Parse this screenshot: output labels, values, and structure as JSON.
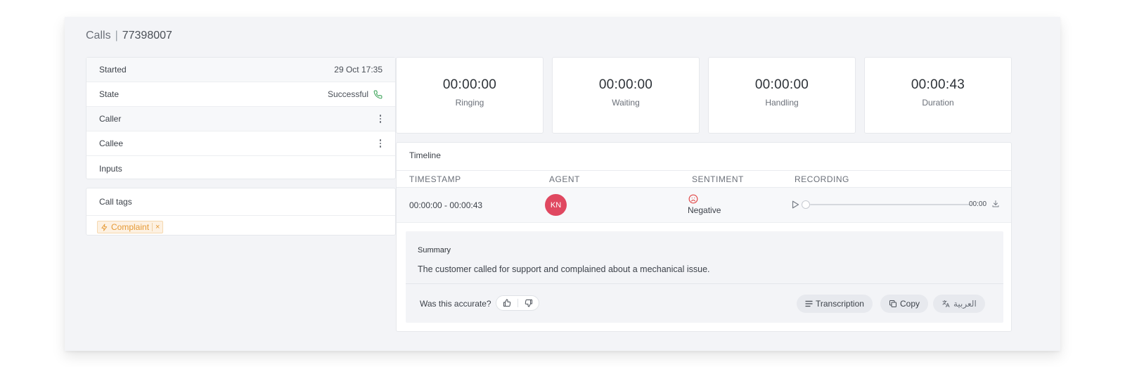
{
  "breadcrumb": {
    "section": "Calls",
    "separator": "|",
    "id": "77398007"
  },
  "info": {
    "rows": [
      {
        "label": "Started",
        "value": "29 Oct 17:35"
      },
      {
        "label": "State",
        "value": "Successful"
      },
      {
        "label": "Caller"
      },
      {
        "label": "Callee"
      },
      {
        "label": "Inputs"
      }
    ]
  },
  "tags": {
    "title": "Call tags",
    "items": [
      {
        "label": "Complaint",
        "remove": "×"
      }
    ]
  },
  "stats": [
    {
      "value": "00:00:00",
      "label": "Ringing"
    },
    {
      "value": "00:00:00",
      "label": "Waiting"
    },
    {
      "value": "00:00:00",
      "label": "Handling"
    },
    {
      "value": "00:00:43",
      "label": "Duration"
    }
  ],
  "timeline": {
    "title": "Timeline",
    "columns": [
      "TIMESTAMP",
      "AGENT",
      "SENTIMENT",
      "RECORDING"
    ],
    "row": {
      "timestamp": "00:00:00 - 00:00:43",
      "agent_initials": "KN",
      "sentiment": "Negative",
      "recording_time": "00:00",
      "recording_progress": 0
    }
  },
  "summary": {
    "heading": "Summary",
    "text": "The customer called for support and complained about a mechanical issue.",
    "feedback_question": "Was this accurate?",
    "buttons": {
      "transcription": "Transcription",
      "copy": "Copy",
      "translate": "العربية"
    }
  },
  "colors": {
    "success": "#3fa55b",
    "tag_accent": "#e59a36",
    "avatar": "#e04860",
    "negative": "#e24a4a"
  }
}
